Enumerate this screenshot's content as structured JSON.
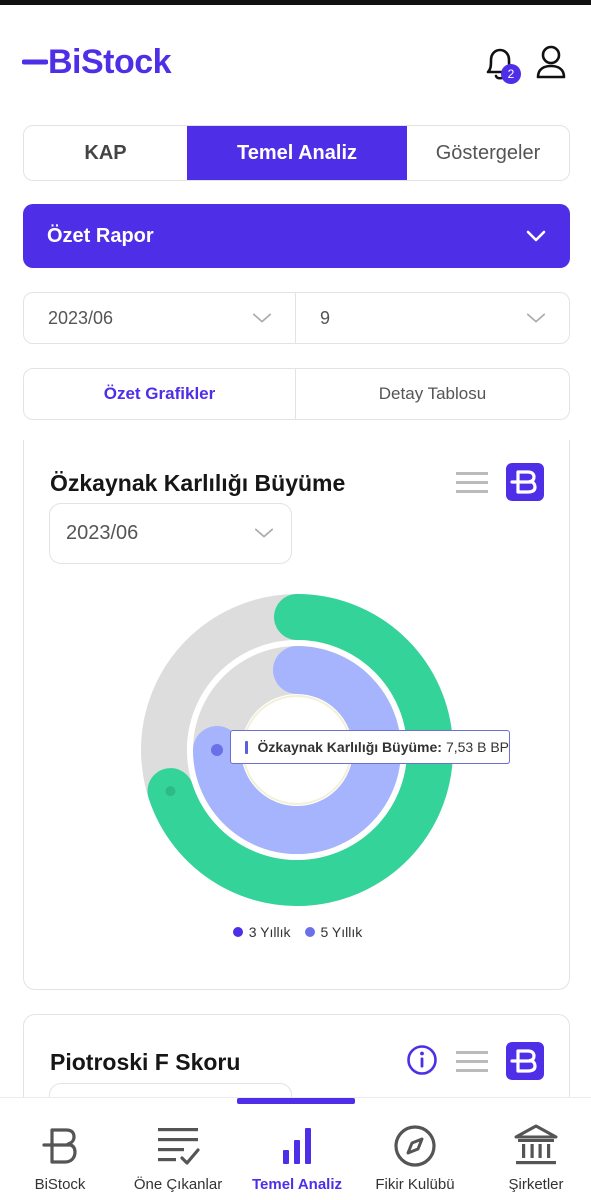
{
  "header": {
    "brand": "BiStock",
    "notification_count": "2"
  },
  "tabs": [
    {
      "label": "KAP"
    },
    {
      "label": "Temel Analiz",
      "active": true
    },
    {
      "label": "Göstergeler"
    }
  ],
  "report_select": {
    "value": "Özet Rapor"
  },
  "period": {
    "date": "2023/06",
    "month": "9"
  },
  "view_toggle": [
    {
      "label": "Özet Grafikler",
      "active": true
    },
    {
      "label": "Detay Tablosu"
    }
  ],
  "card1": {
    "title": "Özkaynak Karlılığı Büyüme",
    "select_value": "2023/06",
    "tooltip": {
      "label": "Özkaynak Karlılığı Büyüme:",
      "value": "7,53 B BP"
    },
    "legend": [
      {
        "name": "3 Yıllık",
        "color": "#4f2ee8"
      },
      {
        "name": "5 Yıllık",
        "color": "#6b70e8"
      }
    ]
  },
  "card2": {
    "title": "Piotroski F Skoru"
  },
  "chart_data": {
    "type": "pie",
    "title": "Özkaynak Karlılığı Büyüme",
    "series": [
      {
        "name": "3 Yıllık",
        "fraction": 0.7,
        "color": "#34d399"
      },
      {
        "name": "5 Yıllık",
        "fraction": 0.75,
        "color": "#a5b4fc"
      }
    ],
    "tooltip_value": "7,53 B BP"
  },
  "colors": {
    "accent": "#4f2ee8",
    "green": "#34d399",
    "lavender": "#a5b4fc",
    "track": "#dddddd"
  },
  "bottom_nav": [
    {
      "label": "BiStock",
      "icon": "bistock-logo-icon"
    },
    {
      "label": "Öne Çıkanlar",
      "icon": "list-check-icon"
    },
    {
      "label": "Temel Analiz",
      "icon": "bar-chart-icon",
      "active": true
    },
    {
      "label": "Fikir Kulübü",
      "icon": "compass-icon"
    },
    {
      "label": "Şirketler",
      "icon": "bank-icon"
    }
  ]
}
